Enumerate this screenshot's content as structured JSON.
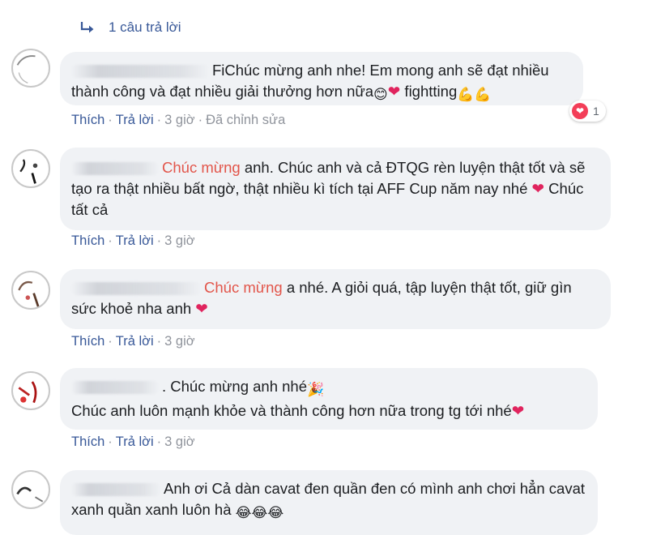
{
  "reply_link": {
    "label": "1 câu trả lời"
  },
  "comments": [
    {
      "name_visible": "",
      "text_prefix": "FiChúc mừng anh nhe! Em mong anh sẽ đạt nhiều thành công và đạt nhiều giải thưởng hơn nữa",
      "text_emoji": "😊",
      "text_heart": "❤",
      "text_suffix": " fightting",
      "text_emoji2": "💪💪",
      "actions": {
        "like": "Thích",
        "reply": "Trả lời",
        "time": "3 giờ",
        "edited": "Đã chỉnh sửa"
      },
      "reaction": {
        "icon": "heart-reaction-icon",
        "count": "1"
      }
    },
    {
      "highlight": "Chúc mừng",
      "text": "anh. Chúc anh và cả ĐTQG rèn luyện thật tốt và sẽ tạo ra thật nhiều bất ngờ, thật nhiều kì tích tại AFF Cup năm nay nhé",
      "text_heart": "❤",
      "text_suffix": " Chúc tất cả",
      "actions": {
        "like": "Thích",
        "reply": "Trả lời",
        "time": "3 giờ"
      }
    },
    {
      "highlight": "Chúc mừng",
      "text": "a nhé. A giỏi quá, tập luyện thật tốt, giữ gìn sức khoẻ nha anh",
      "text_heart": "❤",
      "actions": {
        "like": "Thích",
        "reply": "Trả lời",
        "time": "3 giờ"
      }
    },
    {
      "line1": ". Chúc mừng anh nhé",
      "line1_emoji": "🎉",
      "line2": "Chúc anh luôn mạnh khỏe và thành công hơn nữa trong tg tới nhé",
      "text_heart": "❤",
      "actions": {
        "like": "Thích",
        "reply": "Trả lời",
        "time": "3 giờ"
      }
    },
    {
      "text": "Anh ơi Cả dàn cavat đen quần đen có mình anh chơi hẳn cavat xanh quần xanh luôn hà",
      "text_emoji": "😂😂😂"
    }
  ],
  "colors": {
    "link": "#385898",
    "meta_grey": "#90949c",
    "bubble": "#f0f2f5",
    "highlight": "#e2554a",
    "heart": "#e0245e"
  },
  "icons": {
    "reply_arrow": "reply-arrow-icon",
    "heart": "heart-icon"
  }
}
